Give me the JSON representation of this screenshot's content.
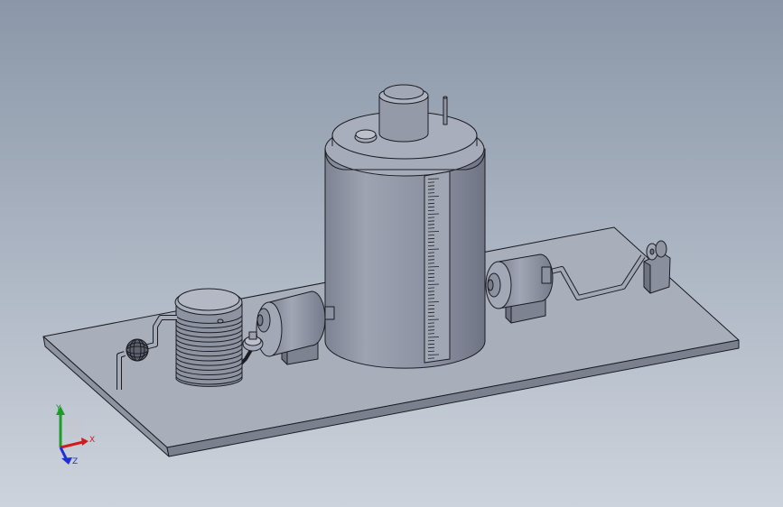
{
  "triad": {
    "x_label": "X",
    "y_label": "Y",
    "z_label": "Z"
  },
  "colors": {
    "bg_top": "#8b97a8",
    "bg_bottom": "#cdd3dc",
    "part_light": "#a4a9b8",
    "part_mid": "#8c91a1",
    "part_dark": "#6e7382",
    "edge": "#1c1d22",
    "axis_x": "#d11c1c",
    "axis_y": "#1e9c2a",
    "axis_z": "#1f2fd6"
  }
}
